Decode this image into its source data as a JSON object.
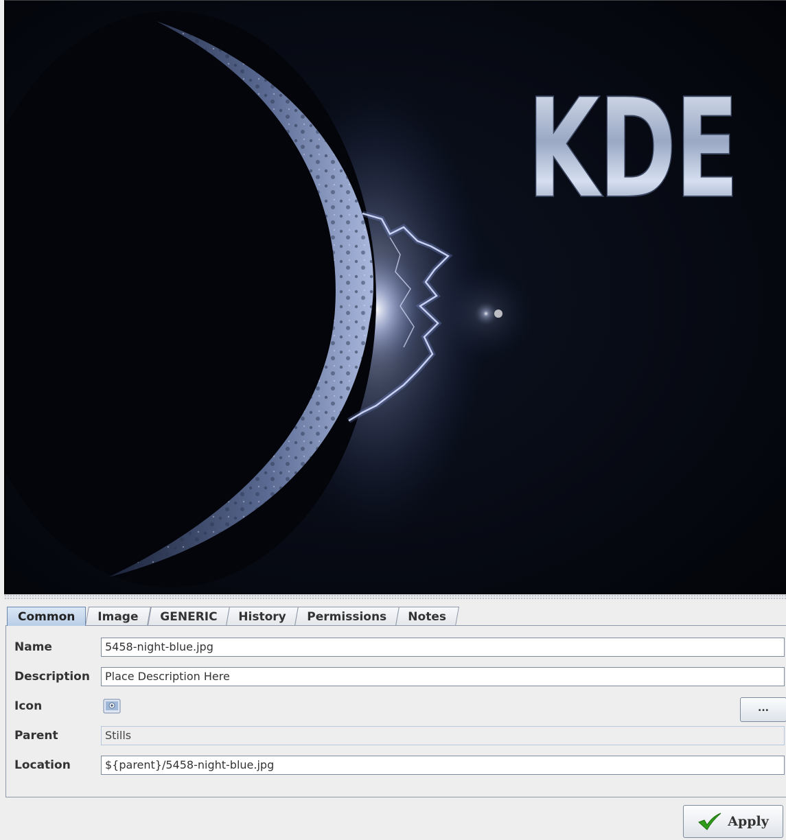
{
  "preview": {
    "logo_text": "KDE"
  },
  "tabs": [
    "Common",
    "Image",
    "GENERIC",
    "History",
    "Permissions",
    "Notes"
  ],
  "active_tab": "Common",
  "form": {
    "name_label": "Name",
    "name_value": "5458-night-blue.jpg",
    "description_label": "Description",
    "description_value": "Place Description Here",
    "icon_label": "Icon",
    "icon_browse": "...",
    "parent_label": "Parent",
    "parent_value": "Stills",
    "location_label": "Location",
    "location_value": "${parent}/5458-night-blue.jpg"
  },
  "apply_label": "Apply",
  "colors": {
    "moon_glow": "#c8d4ff",
    "background": "#04060c",
    "accent_tab": "#b8cde6",
    "checkmark": "#2e9e1a"
  }
}
